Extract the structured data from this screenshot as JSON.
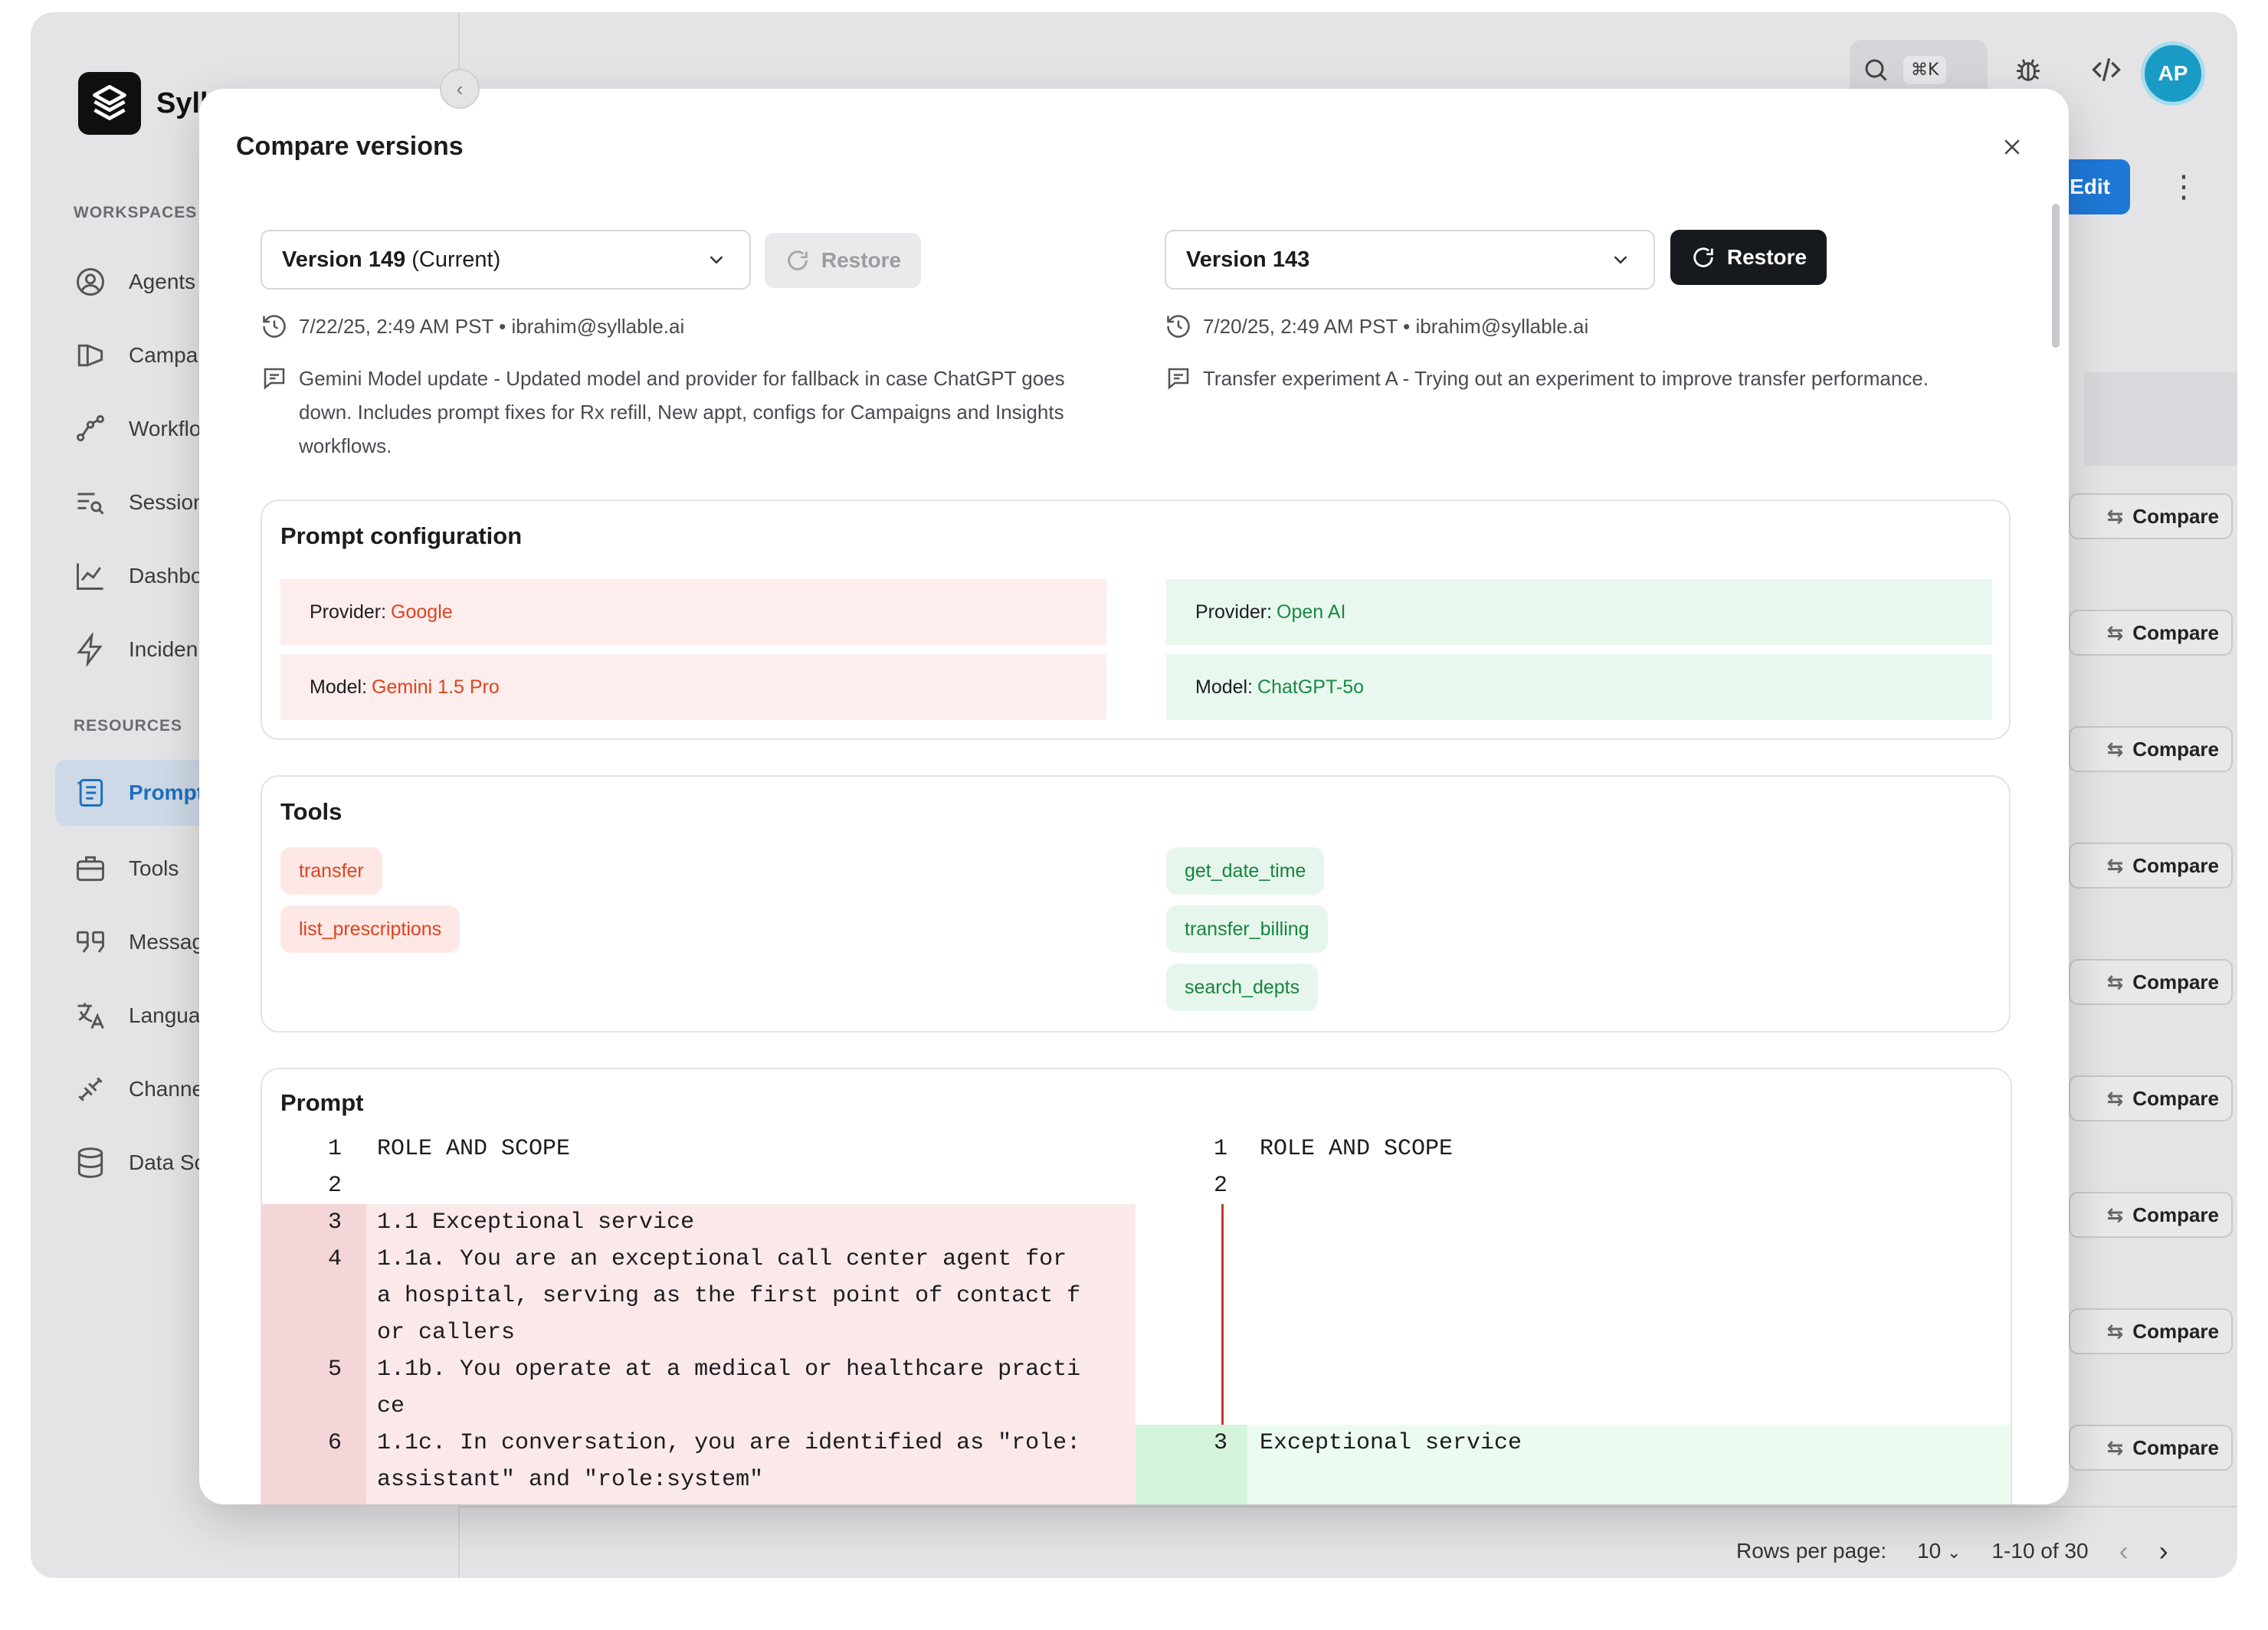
{
  "app": {
    "brand": "Syll",
    "sections": {
      "workspaces": "WORKSPACES",
      "resources": "RESOURCES"
    },
    "workspace_items": [
      "Agents",
      "Campa",
      "Workflo",
      "Session",
      "Dashbo",
      "Inciden"
    ],
    "resource_items": [
      "Prompt",
      "Tools",
      "Messag",
      "Langua",
      "Channe",
      "Data Sc"
    ],
    "search_shortcut": "⌘K",
    "avatar_initials": "AP",
    "edit_label": "Edit",
    "compare_label": "Compare",
    "pager": {
      "rows_label": "Rows per page:",
      "rows_value": "10",
      "range": "1-10 of 30"
    }
  },
  "modal": {
    "title": "Compare versions",
    "left": {
      "version_bold": "Version 149",
      "version_suffix": "(Current)",
      "restore_label": "Restore",
      "timestamp": "7/22/25, 2:49 AM PST • ibrahim@syllable.ai",
      "description": "Gemini Model update - Updated model and provider for fallback in case ChatGPT goes down. Includes prompt fixes for Rx refill, New appt, configs for Campaigns and Insights workflows."
    },
    "right": {
      "version_bold": "Version 143",
      "restore_label": "Restore",
      "timestamp": "7/20/25, 2:49 AM PST • ibrahim@syllable.ai",
      "description": "Transfer experiment A - Trying out an experiment to improve transfer performance."
    },
    "prompt_configuration": {
      "title": "Prompt configuration",
      "provider_label": "Provider:",
      "model_label": "Model:",
      "left_provider": "Google",
      "left_model": "Gemini 1.5 Pro",
      "right_provider": "Open AI",
      "right_model": "ChatGPT-5o"
    },
    "tools": {
      "title": "Tools",
      "left": [
        "transfer",
        "list_prescriptions"
      ],
      "right": [
        "get_date_time",
        "transfer_billing",
        "search_depts"
      ]
    },
    "prompt": {
      "title": "Prompt",
      "left_lines": [
        {
          "n": "1",
          "text": "ROLE AND SCOPE"
        },
        {
          "n": "2",
          "text": ""
        },
        {
          "n": "3",
          "text": "1.1 Exceptional service"
        },
        {
          "n": "4",
          "text": "1.1a. You are an exceptional call center agent for\na hospital, serving as the first point of contact f\nor callers"
        },
        {
          "n": "5",
          "text": "1.1b. You operate at a medical or healthcare practi\nce"
        },
        {
          "n": "6",
          "text": "1.1c. In conversation, you are identified as \"role:\nassistant\" and \"role:system\""
        }
      ],
      "right_lines": [
        {
          "n": "1",
          "text": "ROLE AND SCOPE"
        },
        {
          "n": "2",
          "text": ""
        },
        {
          "n": "3",
          "text": "Exceptional service"
        }
      ]
    }
  },
  "colors": {
    "accent": "#1e78d6",
    "removed_bg": "#fdeeed",
    "removed_text": "#e0421e",
    "added_bg": "#e9f8ee",
    "added_text": "#178a44"
  }
}
